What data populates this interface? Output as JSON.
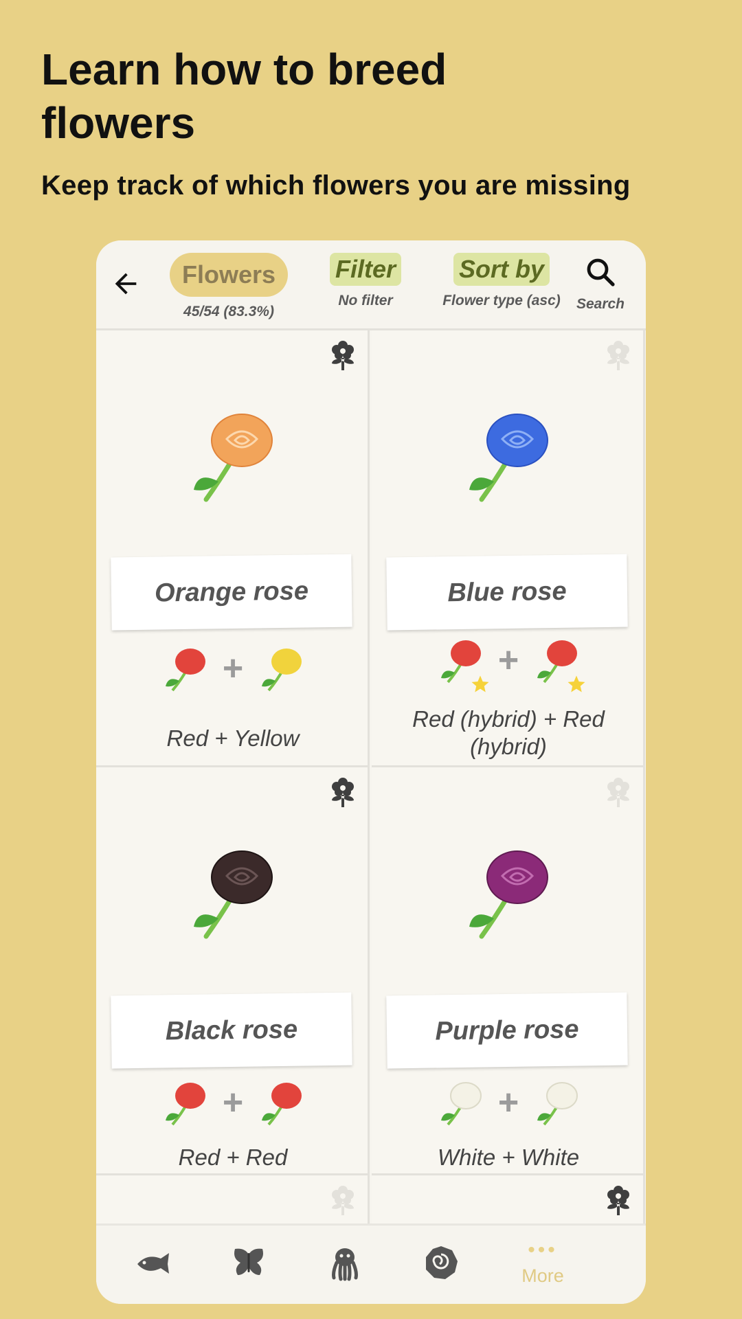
{
  "headline": "Learn how to breed flowers",
  "subline": "Keep track of which flowers you are missing",
  "colors": {
    "background": "#e8d186",
    "accent_pill": "#dde5a3",
    "card": "#f8f6f0"
  },
  "topbar": {
    "back_icon": "arrow-left-icon",
    "tabs": [
      {
        "label": "Flowers",
        "sub": "45/54 (83.3%)"
      },
      {
        "label": "Filter",
        "sub": "No filter"
      },
      {
        "label": "Sort by",
        "sub": "Flower type (asc)"
      }
    ],
    "search": {
      "icon": "search-icon",
      "label": "Search"
    }
  },
  "flowers": [
    {
      "name": "Orange rose",
      "recipe": "Red + Yellow",
      "color": "#f2a45a",
      "parents": [
        "#e2443c",
        "#f1d33c"
      ],
      "hybrid": false,
      "collected": true
    },
    {
      "name": "Blue rose",
      "recipe": "Red (hybrid) + Red (hybrid)",
      "color": "#3d6be0",
      "parents": [
        "#e2443c",
        "#e2443c"
      ],
      "hybrid": true,
      "collected": false
    },
    {
      "name": "Black rose",
      "recipe": "Red + Red",
      "color": "#3b2a2a",
      "parents": [
        "#e2443c",
        "#e2443c"
      ],
      "hybrid": false,
      "collected": true
    },
    {
      "name": "Purple rose",
      "recipe": "White + White",
      "color": "#8b2a78",
      "parents": [
        "#f4f2e6",
        "#f4f2e6"
      ],
      "hybrid": false,
      "collected": false
    }
  ],
  "bottom_nav": {
    "items": [
      "fish-icon",
      "butterfly-icon",
      "octopus-icon",
      "fossil-icon"
    ],
    "more_label": "More"
  }
}
